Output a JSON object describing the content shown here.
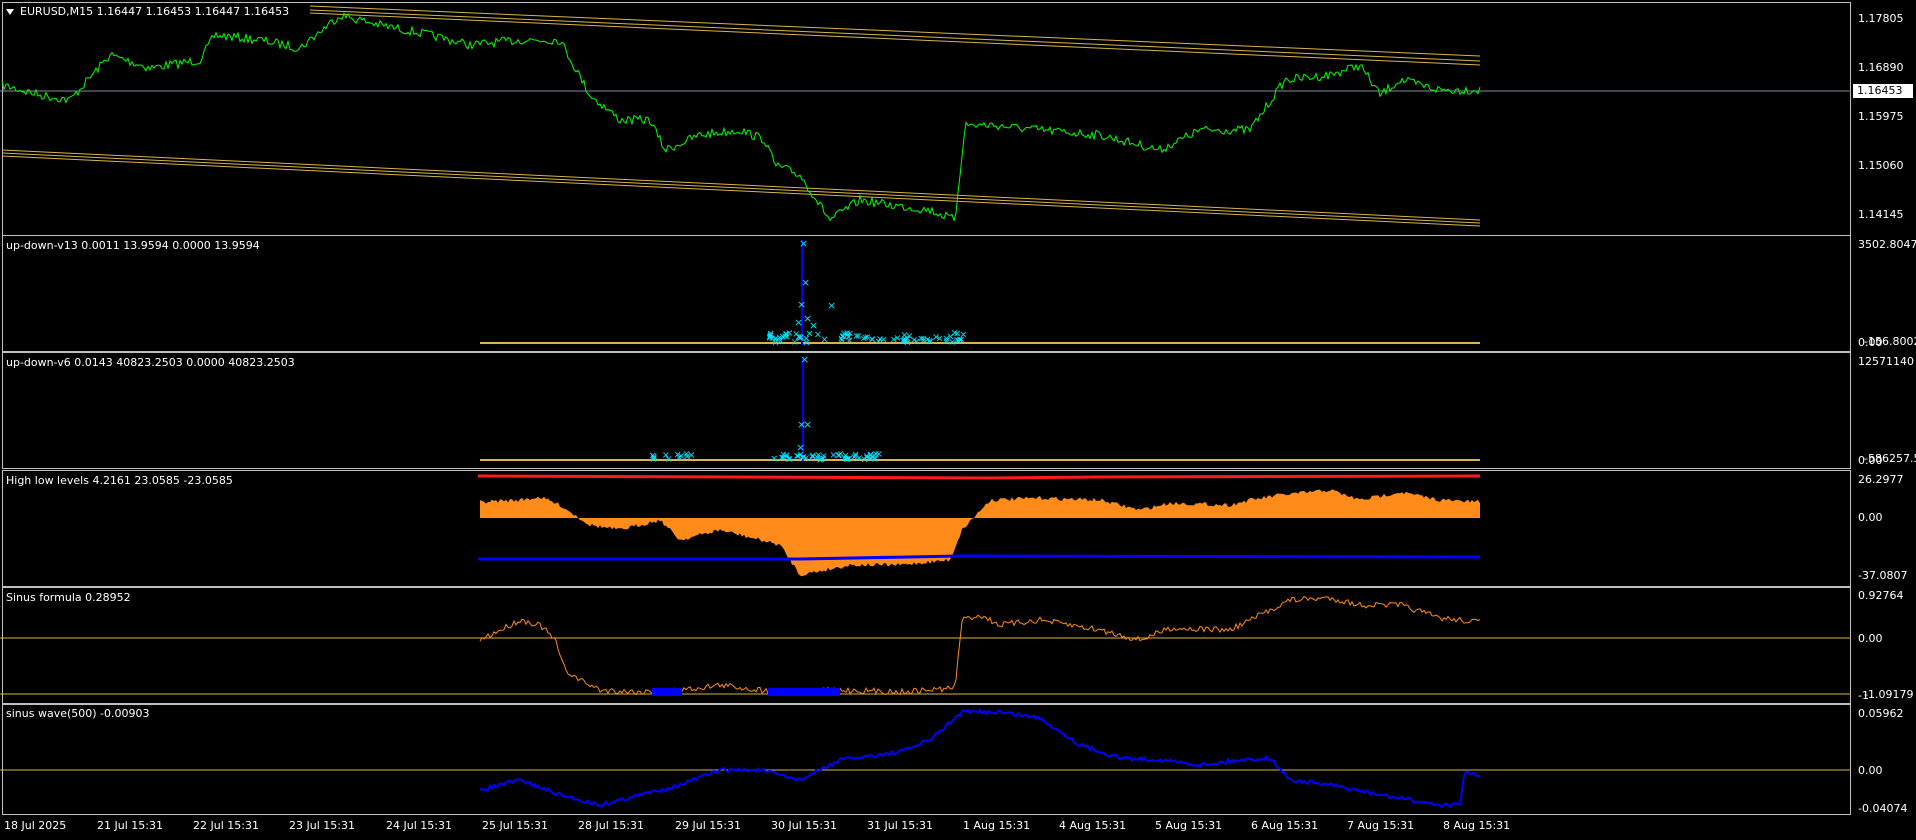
{
  "main": {
    "header": "EURUSD,M15  1.16447 1.16453 1.16447 1.16453",
    "price_ticks": [
      "1.17805",
      "1.16890",
      "1.15975",
      "1.15060",
      "1.14145"
    ],
    "current_price": "1.16453"
  },
  "panes": [
    {
      "title": "up-down-v13 0.0011 13.9594 0.0000 13.9594",
      "scale_top": "3502.8047",
      "scale_bottom_a": "0.00",
      "scale_bottom_b": "-156.8002"
    },
    {
      "title": "up-down-v6 0.0143 40823.2503 0.0000 40823.2503",
      "scale_top": "12571140",
      "scale_bottom_a": "0.00",
      "scale_bottom_b": "-586257.5"
    },
    {
      "title": "High low levels 4.2161 23.0585 -23.0585",
      "scale_top": "26.2977",
      "scale_mid": "0.00",
      "scale_bottom": "-37.0807"
    },
    {
      "title": "Sinus formula 0.28952",
      "scale_top": "0.92764",
      "scale_mid": "0.00",
      "scale_bottom_a": "-1",
      "scale_bottom_b": "-1.09179"
    },
    {
      "title": "sinus wave(500) -0.00903",
      "scale_top": "0.05962",
      "scale_mid": "0.00",
      "scale_bottom": "-0.04074"
    }
  ],
  "time_axis": [
    "18 Jul 2025",
    "21 Jul 15:31",
    "22 Jul 15:31",
    "23 Jul 15:31",
    "24 Jul 15:31",
    "25 Jul 15:31",
    "28 Jul 15:31",
    "29 Jul 15:31",
    "30 Jul 15:31",
    "31 Jul 15:31",
    "1 Aug 15:31",
    "4 Aug 15:31",
    "5 Aug 15:31",
    "6 Aug 15:31",
    "7 Aug 15:31",
    "8 Aug 15:31"
  ],
  "colors": {
    "price_line": "#00ff00",
    "channel": "#d9b44a",
    "grid_border": "#c0c0c0",
    "hist_orange": "#ff8c1a",
    "high_level": "#ff1a1a",
    "low_level": "#0000ff",
    "marker": "#00e5ff",
    "spike": "#0000ff"
  }
}
